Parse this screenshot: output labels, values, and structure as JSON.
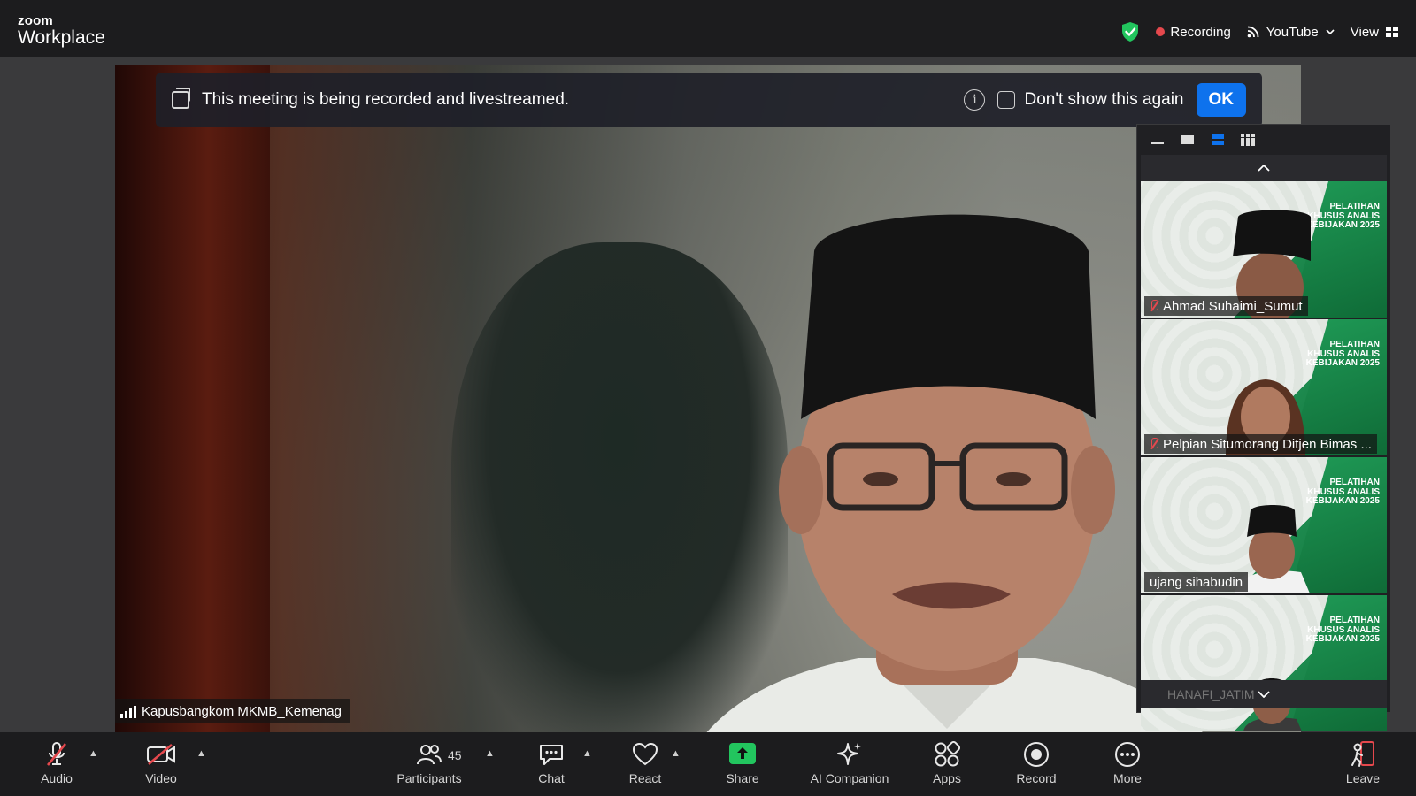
{
  "app": {
    "logo_top": "zoom",
    "logo_bottom": "Workplace"
  },
  "top_right": {
    "recording_label": "Recording",
    "stream_label": "YouTube",
    "view_label": "View"
  },
  "banner": {
    "message": "This meeting is being recorded and livestreamed.",
    "checkbox_label": "Don't show this again",
    "ok_label": "OK"
  },
  "main_video": {
    "speaker_name": "Kapusbangkom MKMB_Kemenag"
  },
  "gallery": {
    "tiles": [
      {
        "name": "Ahmad Suhaimi_Sumut",
        "muted": true,
        "banner_text": "PELATIHAN KHUSUS ANALIS KEBIJAKAN 2025"
      },
      {
        "name": "Pelpian Situmorang Ditjen Bimas ...",
        "muted": true,
        "banner_text": "PELATIHAN KHUSUS ANALIS KEBIJAKAN 2025"
      },
      {
        "name": "ujang sihabudin",
        "muted": false,
        "banner_text": "PELATIHAN KHUSUS ANALIS KEBIJAKAN 2025"
      },
      {
        "name": "",
        "muted": false,
        "banner_text": "PELATIHAN KHUSUS ANALIS KEBIJAKAN 2025"
      }
    ],
    "bottom_label": "HANAFI_JATIM"
  },
  "toolbar": {
    "audio_label": "Audio",
    "video_label": "Video",
    "participants_label": "Participants",
    "participants_count": "45",
    "chat_label": "Chat",
    "react_label": "React",
    "share_label": "Share",
    "ai_label": "AI Companion",
    "apps_label": "Apps",
    "record_label": "Record",
    "more_label": "More",
    "leave_label": "Leave"
  },
  "colors": {
    "accent": "#0e72ed",
    "recording": "#e5484d",
    "share": "#22c55e",
    "secure": "#22c55e"
  }
}
